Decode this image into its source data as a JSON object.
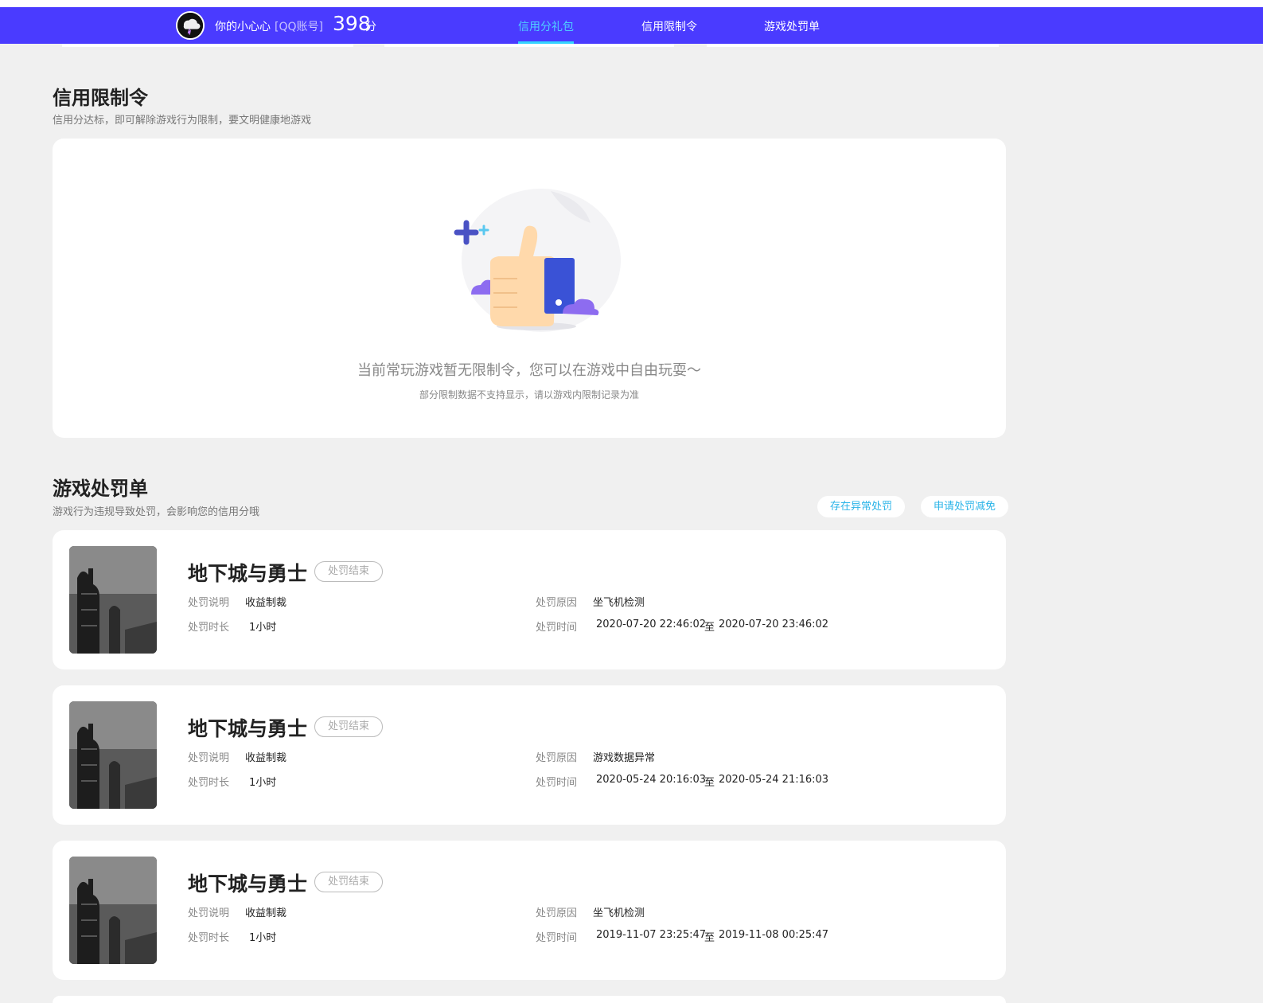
{
  "header": {
    "nickname": "你的小心心",
    "account_tag": "[QQ账号]",
    "score": "398",
    "score_unit": "分",
    "tabs": [
      {
        "label": "信用分礼包",
        "active": true
      },
      {
        "label": "信用限制令",
        "active": false
      },
      {
        "label": "游戏处罚单",
        "active": false
      }
    ],
    "accent_color": "#4a3bff",
    "active_tab_color": "#4fd0ff"
  },
  "restriction": {
    "title": "信用限制令",
    "subtitle": "信用分达标，即可解除游戏行为限制，要文明健康地游戏",
    "empty_main": "当前常玩游戏暂无限制令，您可以在游戏中自由玩耍～",
    "empty_sub": "部分限制数据不支持显示，请以游戏内限制记录为准",
    "illustration_icon": "thumbs-up-icon"
  },
  "penalty": {
    "title": "游戏处罚单",
    "subtitle": "游戏行为违规导致处罚，会影响您的信用分哦",
    "btn_abnormal": "存在异常处罚",
    "btn_apply": "申请处罚减免",
    "labels": {
      "desc": "处罚说明",
      "duration": "处罚时长",
      "reason": "处罚原因",
      "time": "处罚时间",
      "to": "至"
    },
    "records": [
      {
        "game": "地下城与勇士",
        "status": "处罚结束",
        "desc": "收益制裁",
        "duration": "1小时",
        "reason": "坐飞机检测",
        "start": "2020-07-20 22:46:02",
        "end": "2020-07-20 23:46:02"
      },
      {
        "game": "地下城与勇士",
        "status": "处罚结束",
        "desc": "收益制裁",
        "duration": "1小时",
        "reason": "游戏数据异常",
        "start": "2020-05-24 20:16:03",
        "end": "2020-05-24 21:16:03"
      },
      {
        "game": "地下城与勇士",
        "status": "处罚结束",
        "desc": "收益制裁",
        "duration": "1小时",
        "reason": "坐飞机检测",
        "start": "2019-11-07 23:25:47",
        "end": "2019-11-08 00:25:47"
      }
    ]
  }
}
